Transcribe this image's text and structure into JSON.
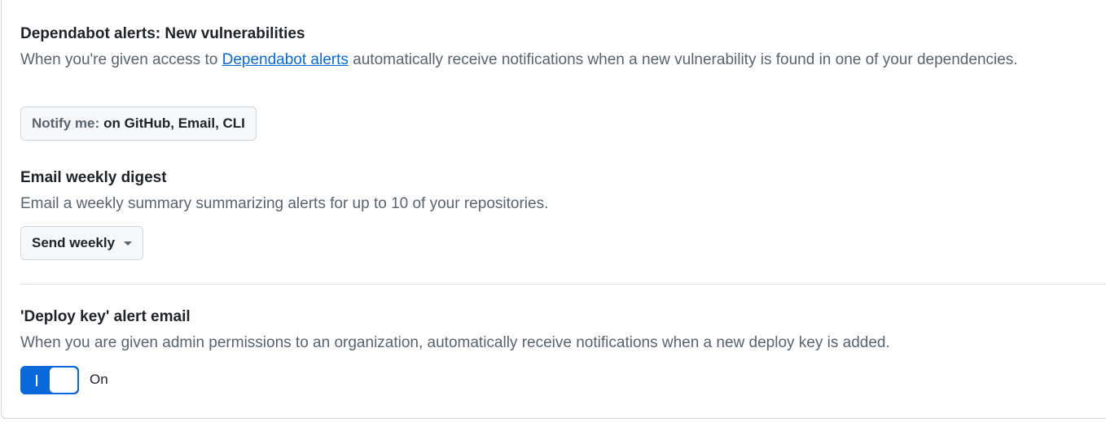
{
  "dependabot": {
    "title": "Dependabot alerts: New vulnerabilities",
    "desc_before": "When you're given access to ",
    "desc_link": "Dependabot alerts",
    "desc_after": " automatically receive notifications when a new vulnerability is found in one of your dependencies.",
    "notify_prefix": "Notify me:",
    "notify_value": "on GitHub, Email, CLI"
  },
  "digest": {
    "title": "Email weekly digest",
    "desc": "Email a weekly summary summarizing alerts for up to 10 of your repositories.",
    "select_label": "Send weekly"
  },
  "deploy_key": {
    "title": "'Deploy key' alert email",
    "desc": "When you are given admin permissions to an organization, automatically receive notifications when a new deploy key is added.",
    "toggle_state": "On"
  },
  "colors": {
    "accent": "#0969da",
    "text": "#1f2328",
    "muted": "#59636e",
    "border": "#d0d7de"
  }
}
